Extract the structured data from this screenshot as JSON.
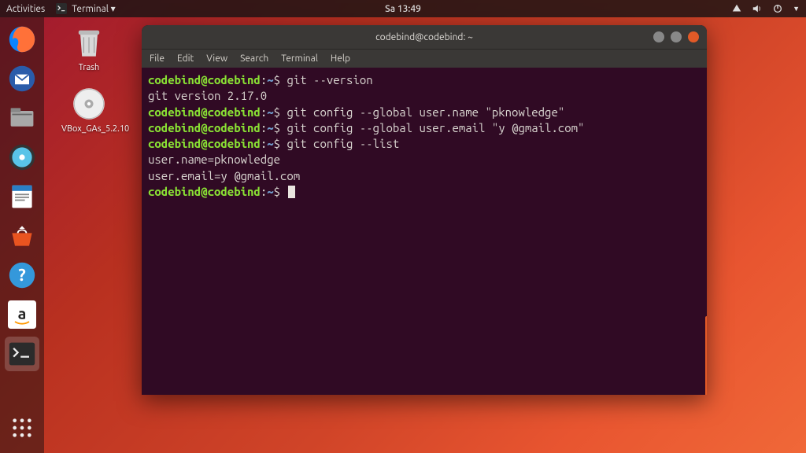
{
  "topbar": {
    "activities": "Activities",
    "app_menu": "Terminal ▾",
    "clock": "Sa 13:49"
  },
  "dock": {
    "items": [
      {
        "name": "firefox"
      },
      {
        "name": "thunderbird"
      },
      {
        "name": "files"
      },
      {
        "name": "rhythmbox"
      },
      {
        "name": "writer"
      },
      {
        "name": "software"
      },
      {
        "name": "help"
      },
      {
        "name": "amazon"
      },
      {
        "name": "terminal"
      }
    ]
  },
  "desktop": {
    "trash_label": "Trash",
    "vbox_label": "VBox_GAs_5.2.10"
  },
  "terminal": {
    "title": "codebind@codebind: ~",
    "menus": {
      "file": "File",
      "edit": "Edit",
      "view": "View",
      "search": "Search",
      "term": "Terminal",
      "help": "Help"
    },
    "prompt": {
      "user": "codebind@codebind",
      "path": "~",
      "sep": ":",
      " $": "$ "
    },
    "lines": {
      "cmd1": "git --version",
      "out1": "git version 2.17.0",
      "cmd2": "git config --global user.name \"pknowledge\"",
      "cmd3": "git config --global user.email \"y            @gmail.com\"",
      "cmd4": "git config --list",
      "out4a": "user.name=pknowledge",
      "out4b": "user.email=y           @gmail.com"
    }
  }
}
